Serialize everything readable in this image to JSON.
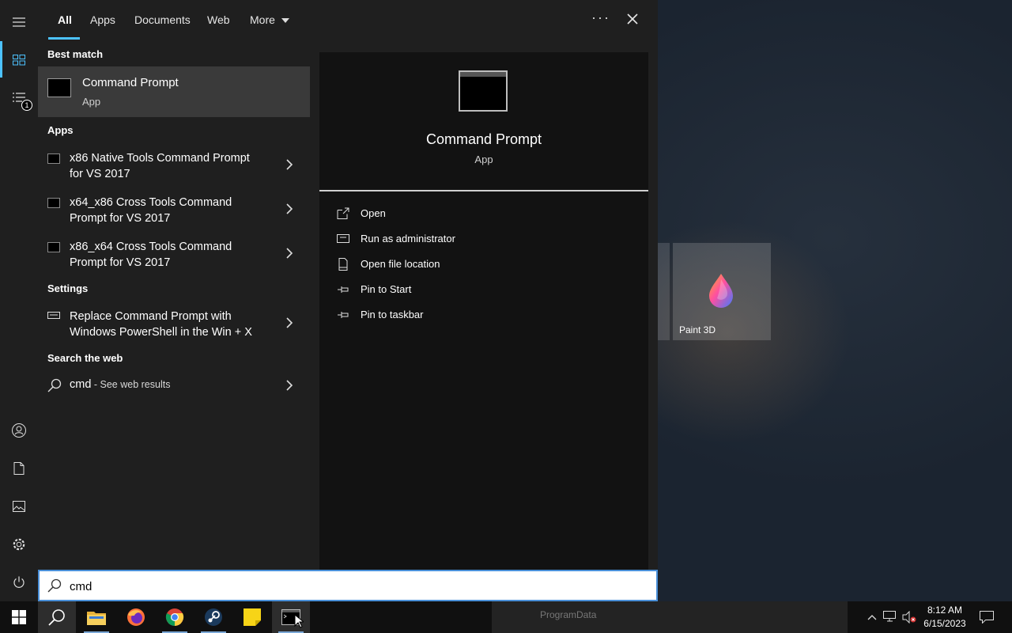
{
  "tabs": [
    {
      "label": "All"
    },
    {
      "label": "Apps"
    },
    {
      "label": "Documents"
    },
    {
      "label": "Web"
    },
    {
      "label": "More"
    }
  ],
  "rail": {
    "badge_count": "1"
  },
  "results": {
    "best_match_heading": "Best match",
    "best_match": {
      "name": "Command Prompt",
      "type": "App"
    },
    "apps_heading": "Apps",
    "apps": [
      {
        "line1": "x86 Native Tools Command Prompt",
        "line2": "for VS 2017"
      },
      {
        "line1": "x64_x86 Cross Tools Command",
        "line2": "Prompt for VS 2017"
      },
      {
        "line1": "x86_x64 Cross Tools Command",
        "line2": "Prompt for VS 2017"
      }
    ],
    "settings_heading": "Settings",
    "settings": [
      {
        "line1": "Replace Command Prompt with",
        "line2": "Windows PowerShell in the Win + X"
      }
    ],
    "web_heading": "Search the web",
    "web": {
      "query": "cmd",
      "suffix": " - See web results"
    }
  },
  "preview": {
    "name": "Command Prompt",
    "type": "App",
    "actions": [
      {
        "label": "Open",
        "icon": "open-icon"
      },
      {
        "label": "Run as administrator",
        "icon": "shield-icon"
      },
      {
        "label": "Open file location",
        "icon": "file-location-icon"
      },
      {
        "label": "Pin to Start",
        "icon": "pin-icon"
      },
      {
        "label": "Pin to taskbar",
        "icon": "pin-icon"
      }
    ]
  },
  "search": {
    "value": "cmd"
  },
  "desktop": {
    "tile_label": "Paint 3D"
  },
  "taskbar": {
    "thumbnail_text": "ProgramData",
    "time": "8:12 AM",
    "date": "6/15/2023"
  },
  "colors": {
    "accent": "#4cc2ff",
    "panel": "#1f1f1f",
    "preview": "#121212",
    "highlight": "#3a3a3a"
  }
}
